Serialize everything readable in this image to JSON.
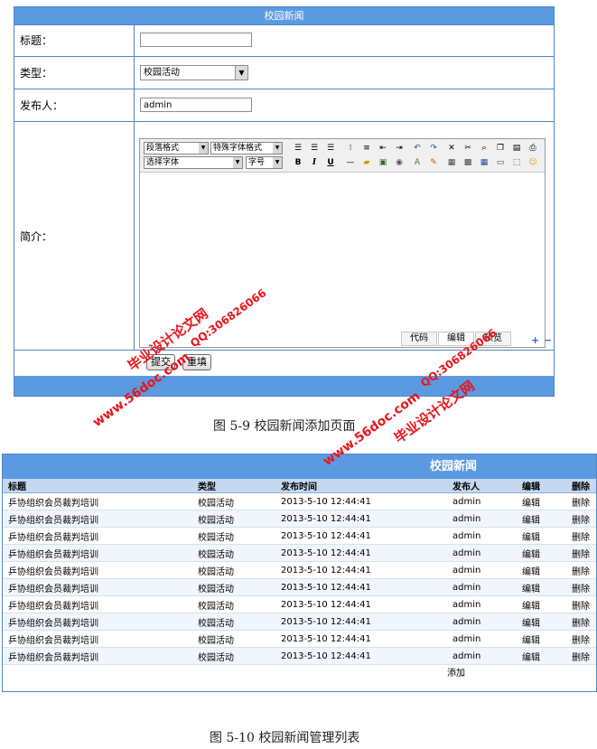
{
  "form": {
    "title": "校园新闻",
    "rows": {
      "title_label": "标题：",
      "title_value": "",
      "type_label": "类型：",
      "type_value": "校园活动",
      "author_label": "发布人：",
      "author_value": "admin",
      "intro_label": "简介："
    },
    "editor": {
      "paragraph_select": "段落格式",
      "special_font_select": "特殊字体格式",
      "font_select": "选择字体",
      "size_select": "字号",
      "tabs": [
        "代码",
        "编辑",
        "预览"
      ],
      "bold": "B",
      "italic": "I",
      "underline": "U"
    },
    "buttons": {
      "submit": "提交",
      "reset": "重填"
    }
  },
  "captions": {
    "fig_5_9": "图 5-9 校园新闻添加页面",
    "fig_5_10": "图 5-10 校园新闻管理列表"
  },
  "list": {
    "title": "校园新闻",
    "headers": [
      "标题",
      "类型",
      "发布时间",
      "发布人",
      "编辑",
      "删除"
    ],
    "rows": [
      [
        "乒协组织会员裁判培训",
        "校园活动",
        "2013-5-10 12:44:41",
        "admin",
        "编辑",
        "删除"
      ],
      [
        "乒协组织会员裁判培训",
        "校园活动",
        "2013-5-10 12:44:41",
        "admin",
        "编辑",
        "删除"
      ],
      [
        "乒协组织会员裁判培训",
        "校园活动",
        "2013-5-10 12:44:41",
        "admin",
        "编辑",
        "删除"
      ],
      [
        "乒协组织会员裁判培训",
        "校园活动",
        "2013-5-10 12:44:41",
        "admin",
        "编辑",
        "删除"
      ],
      [
        "乒协组织会员裁判培训",
        "校园活动",
        "2013-5-10 12:44:41",
        "admin",
        "编辑",
        "删除"
      ],
      [
        "乒协组织会员裁判培训",
        "校园活动",
        "2013-5-10 12:44:41",
        "admin",
        "编辑",
        "删除"
      ],
      [
        "乒协组织会员裁判培训",
        "校园活动",
        "2013-5-10 12:44:41",
        "admin",
        "编辑",
        "删除"
      ],
      [
        "乒协组织会员裁判培训",
        "校园活动",
        "2013-5-10 12:44:41",
        "admin",
        "编辑",
        "删除"
      ],
      [
        "乒协组织会员裁判培训",
        "校园活动",
        "2013-5-10 12:44:41",
        "admin",
        "编辑",
        "删除"
      ],
      [
        "乒协组织会员裁判培训",
        "校园活动",
        "2013-5-10 12:44:41",
        "admin",
        "编辑",
        "删除"
      ]
    ],
    "add_link": "添加"
  },
  "watermarks": {
    "site": "www.56doc.com",
    "name": "毕业设计论文网",
    "qq": "QQ:306826066"
  },
  "colors": {
    "accent": "#5b9ae0",
    "header_row": "#c4d8f0",
    "watermark_red": "#e8141b"
  }
}
